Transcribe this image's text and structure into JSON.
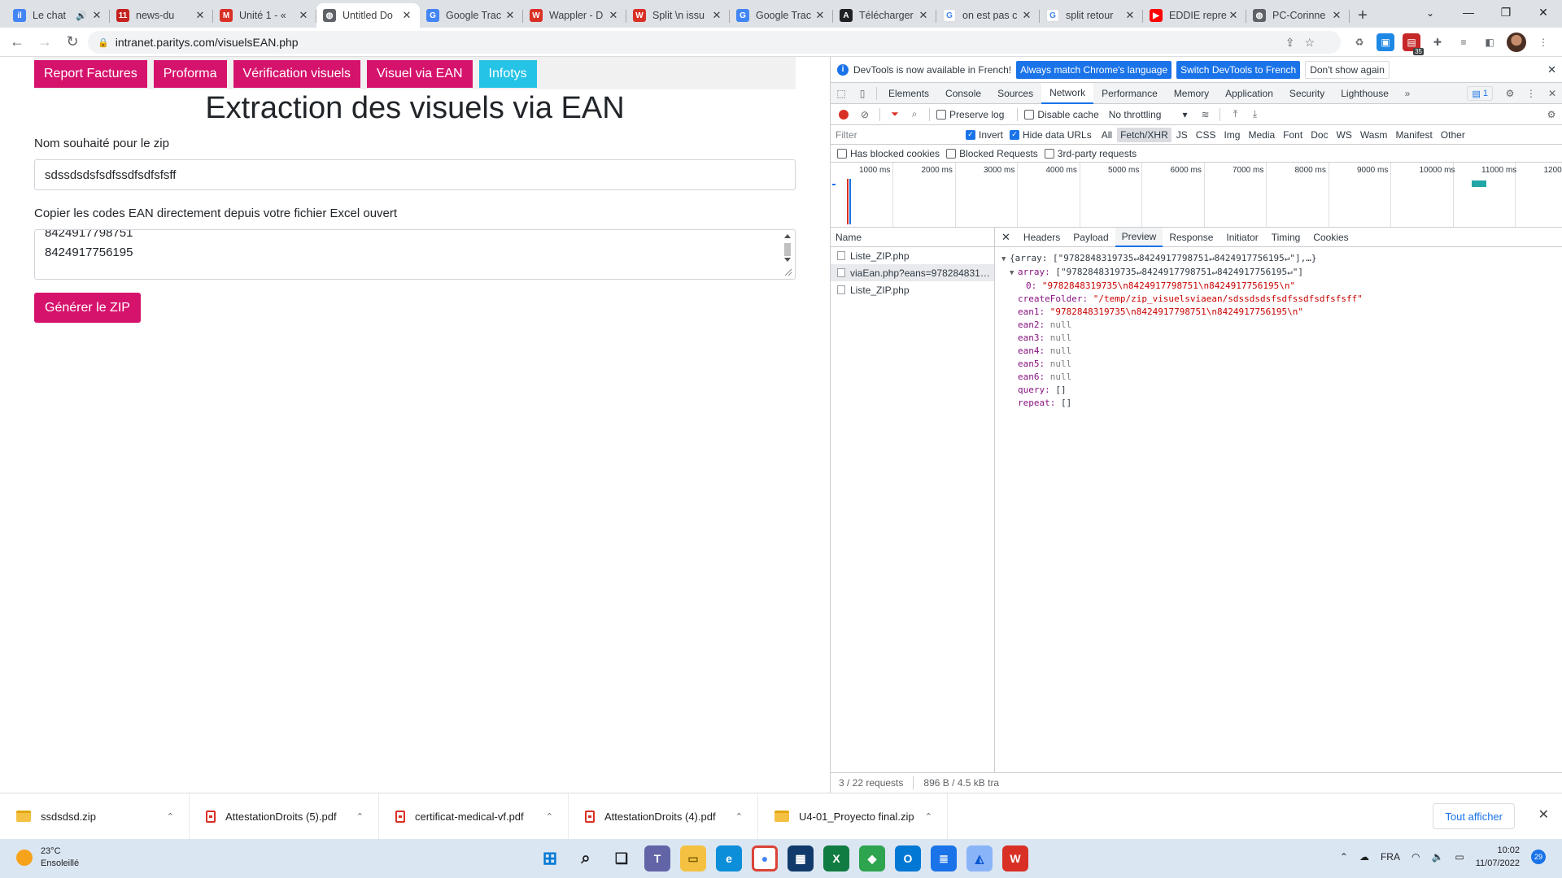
{
  "browser": {
    "tabs": [
      {
        "title": "Le chat",
        "fav_color": "#4285f4",
        "fav_text": "il",
        "audio": true
      },
      {
        "title": "news-du",
        "fav_color": "#c5221f",
        "fav_text": "11"
      },
      {
        "title": "Unité 1 - «",
        "fav_color": "#d93025",
        "fav_text": "M"
      },
      {
        "title": "Untitled Do",
        "fav_color": "#5f6368",
        "fav_text": "◍",
        "active": true
      },
      {
        "title": "Google Trac",
        "fav_color": "#4285f4",
        "fav_text": "G"
      },
      {
        "title": "Wappler - D",
        "fav_color": "#d93025",
        "fav_text": "W"
      },
      {
        "title": "Split \\n issu",
        "fav_color": "#d93025",
        "fav_text": "W"
      },
      {
        "title": "Google Trac",
        "fav_color": "#4285f4",
        "fav_text": "G"
      },
      {
        "title": "Télécharger",
        "fav_color": "#202124",
        "fav_text": "A"
      },
      {
        "title": "on est pas c",
        "fav_color": "#ffffff",
        "fav_text": "G"
      },
      {
        "title": "split retour",
        "fav_color": "#ffffff",
        "fav_text": "G"
      },
      {
        "title": "EDDIE repre",
        "fav_color": "#ff0000",
        "fav_text": "▶"
      },
      {
        "title": "PC-Corinne",
        "fav_color": "#5f6368",
        "fav_text": "◍"
      }
    ],
    "url": "intranet.paritys.com/visuelsEAN.php",
    "ext_badge": "35"
  },
  "page": {
    "nav": [
      "Report Factures",
      "Proforma",
      "Vérification visuels",
      "Visuel via EAN",
      "Infotys"
    ],
    "title": "Extraction des visuels via EAN",
    "zip_label": "Nom souhaité pour le zip",
    "zip_value": "sdssdsdsfsdfssdfsdfsfsff",
    "ean_label": "Copier les codes EAN directement depuis votre fichier Excel ouvert",
    "ean_lines": [
      "8424917798751",
      "8424917756195"
    ],
    "generate_button": "Générer le ZIP"
  },
  "devtools": {
    "banner_text": "DevTools is now available in French!",
    "banner_btn1": "Always match Chrome's language",
    "banner_btn2": "Switch DevTools to French",
    "banner_btn3": "Don't show again",
    "tabs": [
      "Elements",
      "Console",
      "Sources",
      "Network",
      "Performance",
      "Memory",
      "Application",
      "Security",
      "Lighthouse"
    ],
    "active_tab": "Network",
    "issues_count": "1",
    "preserve_log": "Preserve log",
    "disable_cache": "Disable cache",
    "throttling": "No throttling",
    "filter_placeholder": "Filter",
    "invert": "Invert",
    "hide_data_urls": "Hide data URLs",
    "filter_types": [
      "All",
      "Fetch/XHR",
      "JS",
      "CSS",
      "Img",
      "Media",
      "Font",
      "Doc",
      "WS",
      "Wasm",
      "Manifest",
      "Other"
    ],
    "selected_type": "Fetch/XHR",
    "has_blocked_cookies": "Has blocked cookies",
    "blocked_requests": "Blocked Requests",
    "third_party": "3rd-party requests",
    "timeline_ticks": [
      "1000 ms",
      "2000 ms",
      "3000 ms",
      "4000 ms",
      "5000 ms",
      "6000 ms",
      "7000 ms",
      "8000 ms",
      "9000 ms",
      "10000 ms",
      "11000 ms",
      "1200"
    ],
    "name_header": "Name",
    "requests": [
      "Liste_ZIP.php",
      "viaEan.php?eans=978284831…",
      "Liste_ZIP.php"
    ],
    "selected_request": 1,
    "detail_tabs": [
      "Headers",
      "Payload",
      "Preview",
      "Response",
      "Initiator",
      "Timing",
      "Cookies"
    ],
    "active_detail_tab": "Preview",
    "status_requests": "3 / 22 requests",
    "status_transferred": "896 B / 4.5 kB tra",
    "json": {
      "root_summary": "{array: [\"9782848319735↵8424917798751↵8424917756195↵\"],…}",
      "array_key": "array:",
      "array_summary": "[\"9782848319735↵8424917798751↵8424917756195↵\"]",
      "array_0_key": "0:",
      "array_0_val": "\"9782848319735\\n8424917798751\\n8424917756195\\n\"",
      "createFolder_key": "createFolder:",
      "createFolder_val": "\"/temp/zip_visuelsviaean/sdssdsdsfsdfssdfsdfsfsff\"",
      "ean1_key": "ean1:",
      "ean1_val": "\"9782848319735\\n8424917798751\\n8424917756195\\n\"",
      "ean2_key": "ean2:",
      "ean3_key": "ean3:",
      "ean4_key": "ean4:",
      "ean5_key": "ean5:",
      "ean6_key": "ean6:",
      "null_val": "null",
      "query_key": "query:",
      "repeat_key": "repeat:",
      "empty_arr": "[]"
    }
  },
  "downloads": {
    "items": [
      {
        "name": "ssdsdsd.zip",
        "type": "zip"
      },
      {
        "name": "AttestationDroits (5).pdf",
        "type": "pdf"
      },
      {
        "name": "certificat-medical-vf.pdf",
        "type": "pdf"
      },
      {
        "name": "AttestationDroits (4).pdf",
        "type": "pdf"
      },
      {
        "name": "U4-01_Proyecto final.zip",
        "type": "zip"
      }
    ],
    "show_all": "Tout afficher"
  },
  "taskbar": {
    "temp": "23°C",
    "weather": "Ensoleillé",
    "lang": "FRA",
    "time": "10:02",
    "date": "11/07/2022",
    "notifications": "29"
  },
  "colors": {
    "brand_pink": "#d6136c",
    "cyan": "#25c3e6",
    "devtools_blue": "#1a73e8"
  }
}
